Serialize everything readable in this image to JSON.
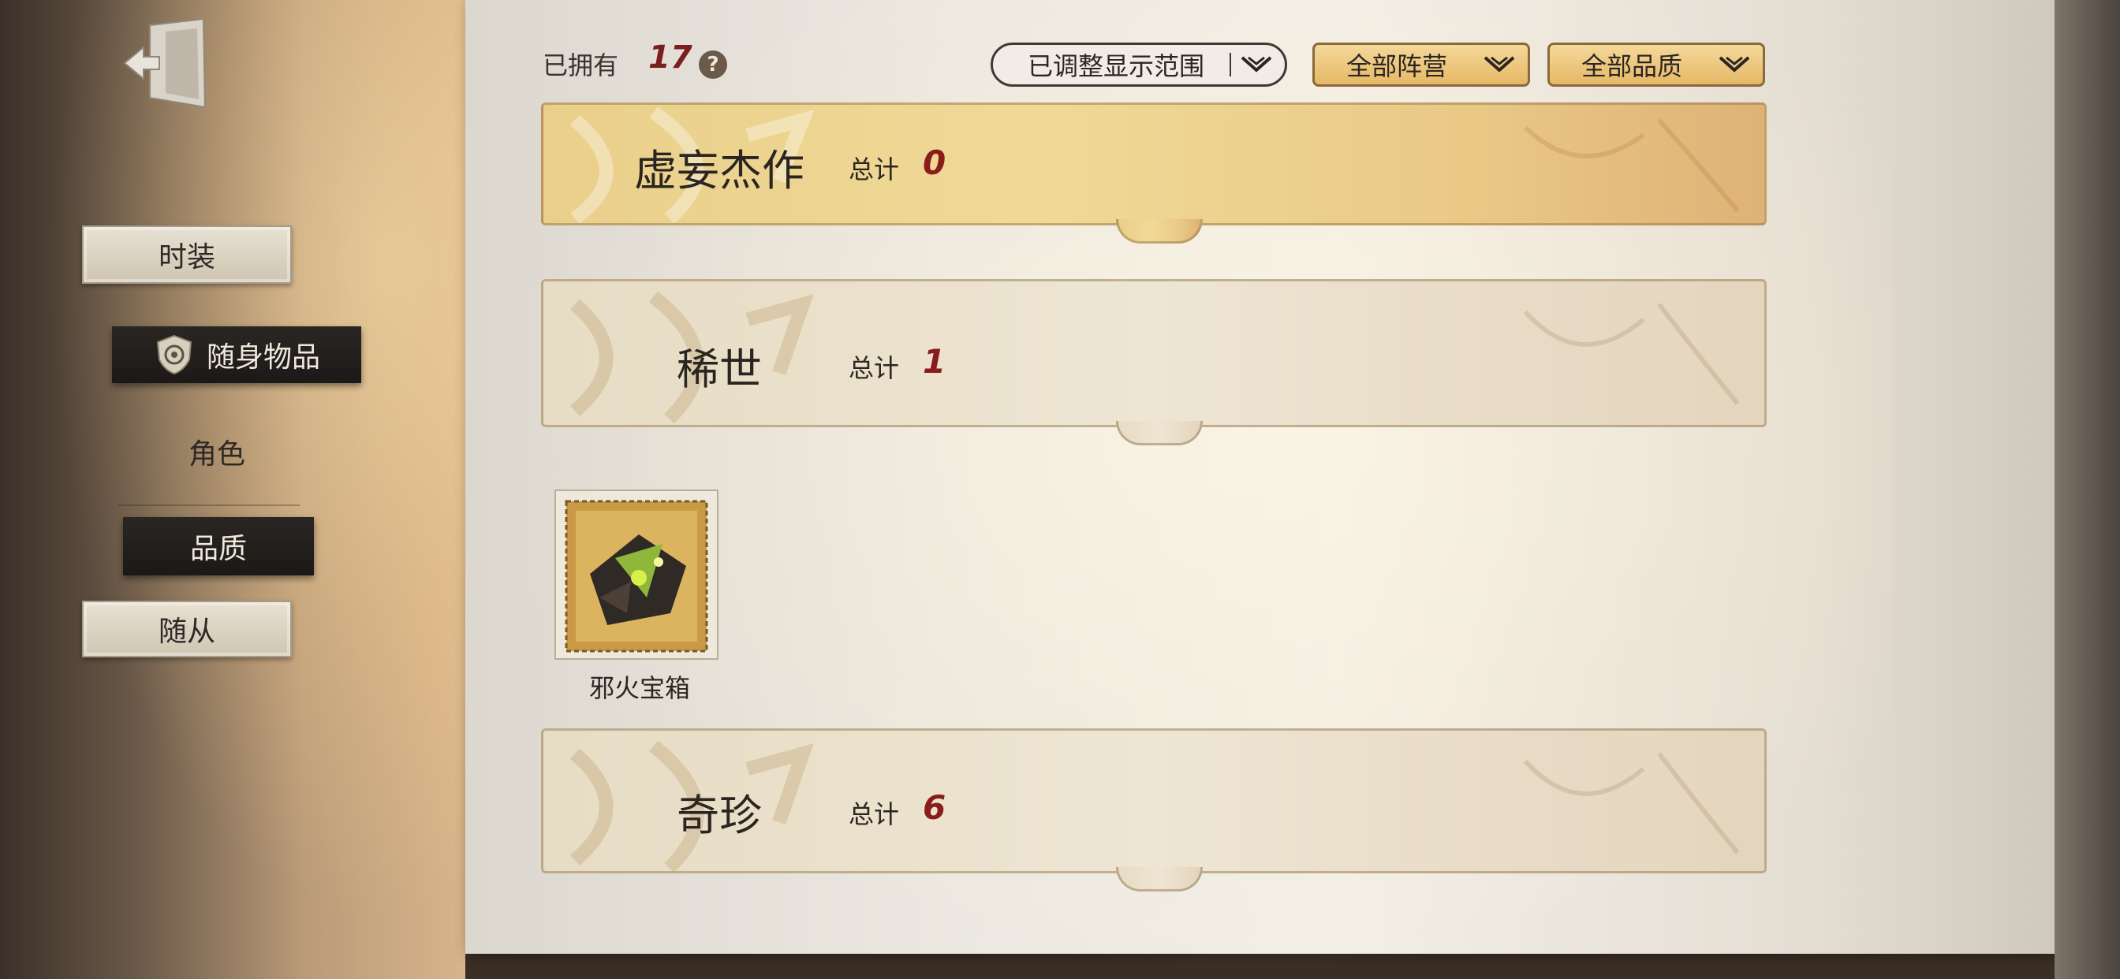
{
  "left_nav": {
    "items": [
      {
        "label": "时装"
      },
      {
        "label": "随身物品"
      },
      {
        "label": "角色"
      },
      {
        "label": "品质"
      },
      {
        "label": "随从"
      }
    ]
  },
  "header": {
    "owned_label": "已拥有",
    "owned_count": "17",
    "help_symbol": "?",
    "range_filter": "已调整显示范围",
    "faction_filter": "全部阵营",
    "quality_filter": "全部品质"
  },
  "categories": [
    {
      "name": "虚妄杰作",
      "total_label": "总计",
      "total": "0"
    },
    {
      "name": "稀世",
      "total_label": "总计",
      "total": "1",
      "items": [
        {
          "name": "邪火宝箱"
        }
      ]
    },
    {
      "name": "奇珍",
      "total_label": "总计",
      "total": "6"
    }
  ],
  "colors": {
    "accent_red": "#8b1c1c",
    "gold_bar": "#f0d997",
    "selected_nav": "#1b1917"
  },
  "icons": {
    "exit": "exit-door-icon",
    "selected_nav": "shield-emblem-icon",
    "help": "question-icon",
    "dropdown": "chevron-down-icon"
  }
}
